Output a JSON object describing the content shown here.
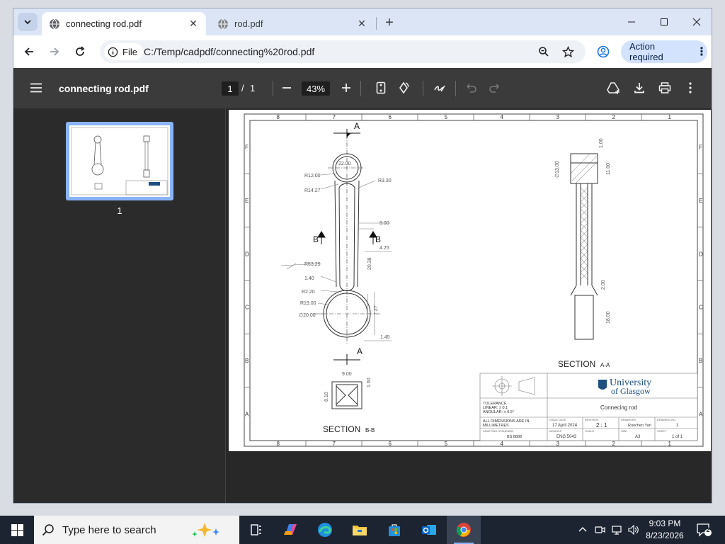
{
  "browser": {
    "tabs": [
      {
        "title": "connecting rod.pdf",
        "active": true
      },
      {
        "title": "rod.pdf",
        "active": false
      }
    ],
    "new_tab_label": "+",
    "url_chip": "File",
    "url": "C:/Temp/cadpdf/connecting%20rod.pdf",
    "action_required": "Action required"
  },
  "pdf": {
    "title": "connecting rod.pdf",
    "page_current": "1",
    "page_sep": "/",
    "page_total": "1",
    "zoom": "43%",
    "thumb_label": "1"
  },
  "drawing": {
    "col_labels": [
      "8",
      "7",
      "6",
      "5",
      "4",
      "3",
      "2",
      "1"
    ],
    "row_labels": [
      "F",
      "E",
      "D",
      "C",
      "B",
      "A"
    ],
    "dims": {
      "r12": "R12.00",
      "r1427": "R14.27",
      "d22": "22.00",
      "r330": "R3.30",
      "d9": "9.00",
      "d425": "4.25",
      "d2038": "20.38",
      "r5325": "R53.25",
      "d140": "1.40",
      "r220": "R2.20",
      "r19": "R19.00",
      "dia20": "∅20.00",
      "d727": "7.27",
      "d145": "1.45",
      "dia13": "∅13.00",
      "d100": "1.00",
      "d1100": "11.00",
      "d200": "2.00",
      "d1800": "18.00",
      "d900b": "9.00",
      "d810": "8.10",
      "d160": "1.60"
    },
    "sec_a_label": "A",
    "sec_b_label": "B",
    "section_aa": "SECTION",
    "section_aa_sub": "A-A",
    "section_bb": "SECTION",
    "section_bb_sub": "B-B",
    "title_block": {
      "university_line1": "University",
      "university_line2": "of Glasgow",
      "tolerance": "TOLERANCE",
      "linear": "LINEAR: ± 0.1",
      "angular": "ANGULAR: ± 0.5°",
      "part_name": "Connecing rod",
      "all_dims1": "ALL DIMENSIONS ARE IN",
      "all_dims2": "MILLIMETRES",
      "issue_date_h": "ISSUE DATE",
      "issue_date": "17 April 2024",
      "revision_h": "REVISION",
      "revision": "2 : 1",
      "drawn_by_h": "DRAWN BY",
      "drawn_by": "Ruochen Yan",
      "drawing_no_h": "DRAWING NO.",
      "drawing_no": "1",
      "standard_h": "DRAFTING STANDARD",
      "standard": "BS 8888",
      "module_h": "MODULE",
      "module": "ENG 5043",
      "scale_h": "SCALE",
      "size_h": "SIZE",
      "size": "A3",
      "sheet_h": "SHEET",
      "sheet": "1 of 1"
    }
  },
  "taskbar": {
    "search_placeholder": "Type here to search",
    "time": "9:03 PM",
    "date": "8/23/2026",
    "notifications": "2"
  },
  "colors": {
    "accent": "#8ab4f8",
    "action_bg": "#d3e3fd",
    "pdf_toolbar": "#3b3b3b"
  }
}
